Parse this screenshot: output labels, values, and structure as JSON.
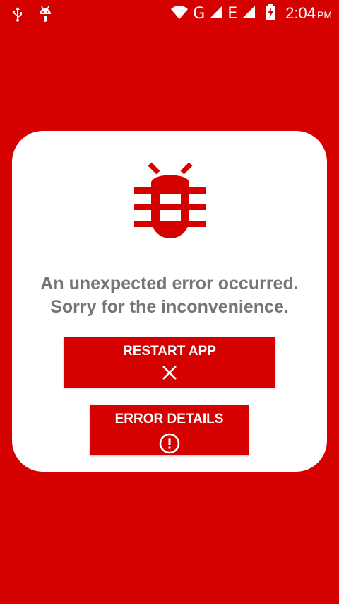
{
  "status_bar": {
    "left_icons": [
      "usb-icon",
      "android-icon"
    ],
    "network_1": "G",
    "network_2": "E",
    "time": "2:04",
    "ampm": "PM",
    "right_icons": [
      "wifi-icon",
      "signal-icon",
      "signal-icon",
      "battery-charging-icon"
    ]
  },
  "dialog": {
    "icon": "bug-icon",
    "message_line1": "An unexpected error occurred.",
    "message_line2": "Sorry for the inconvenience.",
    "restart_button": {
      "label": "RESTART APP",
      "icon": "close-icon"
    },
    "details_button": {
      "label": "ERROR DETAILS",
      "icon": "alert-circle-icon"
    }
  },
  "colors": {
    "background": "#d50000",
    "accent": "#d50000",
    "card": "#ffffff",
    "message_text": "#757575"
  }
}
